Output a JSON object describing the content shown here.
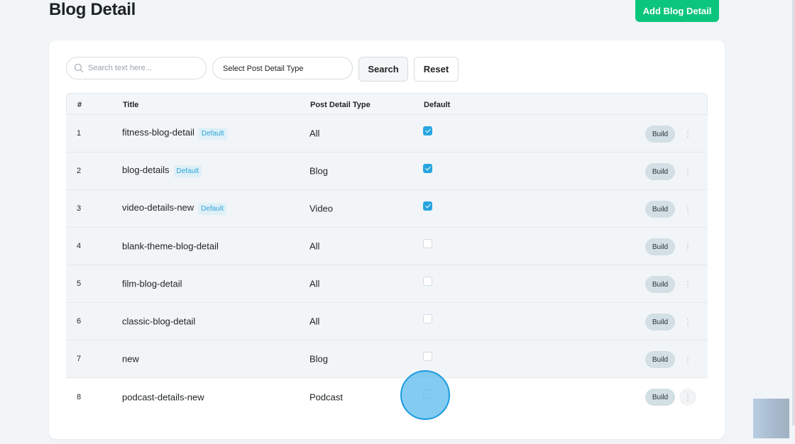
{
  "page": {
    "title": "Blog Detail",
    "add_button": "Add Blog Detail"
  },
  "filters": {
    "search_placeholder": "Search text here...",
    "select_label": "Select Post Detail Type",
    "search_button": "Search",
    "reset_button": "Reset"
  },
  "table": {
    "headers": [
      "#",
      "Title",
      "Post Detail Type",
      "Default"
    ],
    "build_label": "Build",
    "badge_label": "Default",
    "rows": [
      {
        "num": "1",
        "title": "fitness-blog-detail",
        "badge": "Default",
        "type": "All",
        "default": true
      },
      {
        "num": "2",
        "title": "blog-details",
        "badge": "Default",
        "type": "Blog",
        "default": true
      },
      {
        "num": "3",
        "title": "video-details-new",
        "badge": "Default",
        "type": "Video",
        "default": true
      },
      {
        "num": "4",
        "title": "blank-theme-blog-detail",
        "badge": null,
        "type": "All",
        "default": false
      },
      {
        "num": "5",
        "title": "film-blog-detail",
        "badge": null,
        "type": "All",
        "default": false
      },
      {
        "num": "6",
        "title": "classic-blog-detail",
        "badge": null,
        "type": "All",
        "default": false
      },
      {
        "num": "7",
        "title": "new",
        "badge": null,
        "type": "Blog",
        "default": false
      },
      {
        "num": "8",
        "title": "podcast-details-new",
        "badge": null,
        "type": "Podcast",
        "default": false
      }
    ]
  }
}
